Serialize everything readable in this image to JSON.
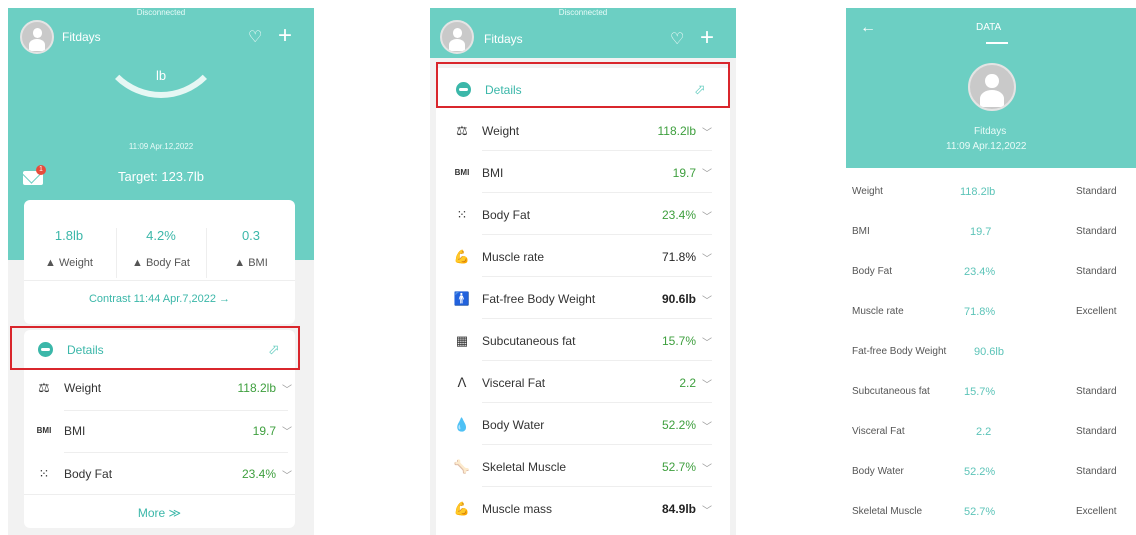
{
  "panel1": {
    "status": "Disconnected",
    "app_name": "Fitdays",
    "heart_icon": "heart-icon",
    "add_icon": "plus-icon",
    "gauge_unit": "lb",
    "timestamp": "11:09 Apr.12,2022",
    "mail_badge": "1",
    "target": "Target: 123.7lb",
    "stats": [
      {
        "value": "1.8lb",
        "label": "▲ Weight"
      },
      {
        "value": "4.2%",
        "label": "▲ Body Fat"
      },
      {
        "value": "0.3",
        "label": "▲ BMI"
      }
    ],
    "contrast": "Contrast 11:44 Apr.7,2022 →",
    "details_label": "Details",
    "metrics": [
      {
        "icon": "kg-weight-icon",
        "symbol": "⚖",
        "label": "Weight",
        "value": "118.2lb"
      },
      {
        "icon": "bmi-icon",
        "symbol": "BMI",
        "label": "BMI",
        "value": "19.7"
      },
      {
        "icon": "body-fat-icon",
        "symbol": "⁙",
        "label": "Body Fat",
        "value": "23.4%"
      }
    ],
    "more": "More ≫"
  },
  "panel2": {
    "status": "Disconnected",
    "app_name": "Fitdays",
    "details_label": "Details",
    "metrics": [
      {
        "icon": "kg-weight-icon",
        "symbol": "⚖",
        "label": "Weight",
        "value": "118.2lb",
        "bold": false
      },
      {
        "icon": "bmi-icon",
        "symbol": "BMI",
        "label": "BMI",
        "value": "19.7",
        "bold": false
      },
      {
        "icon": "body-fat-icon",
        "symbol": "⁙",
        "label": "Body Fat",
        "value": "23.4%",
        "bold": false
      },
      {
        "icon": "muscle-rate-icon",
        "symbol": "💪",
        "label": "Muscle rate",
        "value": "71.8%",
        "bold": false
      },
      {
        "icon": "fat-free-weight-icon",
        "symbol": "🚹",
        "label": "Fat-free Body Weight",
        "value": "90.6lb",
        "bold": true
      },
      {
        "icon": "subcutaneous-fat-icon",
        "symbol": "▦",
        "label": "Subcutaneous fat",
        "value": "15.7%",
        "bold": false
      },
      {
        "icon": "visceral-fat-icon",
        "symbol": "ᐱ",
        "label": "Visceral Fat",
        "value": "2.2",
        "bold": false
      },
      {
        "icon": "body-water-icon",
        "symbol": "💧",
        "label": "Body Water",
        "value": "52.2%",
        "bold": false
      },
      {
        "icon": "skeletal-muscle-icon",
        "symbol": "🦴",
        "label": "Skeletal Muscle",
        "value": "52.7%",
        "bold": false
      },
      {
        "icon": "muscle-mass-icon",
        "symbol": "💪",
        "label": "Muscle mass",
        "value": "84.9lb",
        "bold": true
      }
    ]
  },
  "panel3": {
    "back_icon": "back-arrow-icon",
    "title": "DATA",
    "app_name": "Fitdays",
    "timestamp": "11:09 Apr.12,2022",
    "rows": [
      {
        "name": "Weight",
        "value": "118.2lb",
        "status": "Standard"
      },
      {
        "name": "BMI",
        "value": "19.7",
        "status": "Standard"
      },
      {
        "name": "Body Fat",
        "value": "23.4%",
        "status": "Standard"
      },
      {
        "name": "Muscle rate",
        "value": "71.8%",
        "status": "Excellent"
      },
      {
        "name": "Fat-free Body Weight",
        "value": "90.6lb",
        "status": ""
      },
      {
        "name": "Subcutaneous fat",
        "value": "15.7%",
        "status": "Standard"
      },
      {
        "name": "Visceral Fat",
        "value": "2.2",
        "status": "Standard"
      },
      {
        "name": "Body Water",
        "value": "52.2%",
        "status": "Standard"
      },
      {
        "name": "Skeletal Muscle",
        "value": "52.7%",
        "status": "Excellent"
      }
    ]
  },
  "colors": {
    "teal": "#6ccfc3",
    "accent": "#3bb7a9",
    "value_green": "#3e9f3e",
    "highlight": "#d9262c"
  }
}
